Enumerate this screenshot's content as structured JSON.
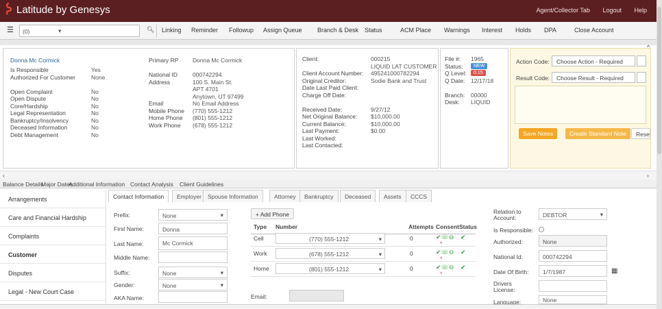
{
  "header": {
    "title": "Latitude by Genesys",
    "agent": "Agent/Collector Tab",
    "logout": "Logout",
    "help": "Help"
  },
  "toolbar": {
    "filter_value": "(0)",
    "items": [
      "Linking",
      "Reminder",
      "Followup",
      "Assign Queue",
      "Branch & Desk",
      "Status",
      "ACM Place",
      "Warnings",
      "Interest",
      "Holds",
      "DPA",
      "Close Account"
    ]
  },
  "summary": {
    "name": "Donna Mc Cormick",
    "left_rows": [
      [
        "Is Responsible",
        "Yes"
      ],
      [
        "Authorized For Customer",
        "None"
      ],
      [
        "",
        ""
      ],
      [
        "Open Complaint",
        "No"
      ],
      [
        "Open Dispute",
        "No"
      ],
      [
        "Core/Hardship",
        "No"
      ],
      [
        "Legal Representation",
        "No"
      ],
      [
        "Bankruptcy/Insolvency",
        "No"
      ],
      [
        "Deceased Information",
        "No"
      ],
      [
        "Debt Management",
        "No"
      ]
    ],
    "contact_rows": [
      [
        "Primary RP",
        "Donna Mc Cormick"
      ],
      [
        "",
        ""
      ],
      [
        "National ID",
        "000742294"
      ],
      [
        "Address",
        "100 S. Main St."
      ],
      [
        "",
        "APT 4701"
      ],
      [
        "",
        "Anytown, UT 97499"
      ],
      [
        "Email",
        "No Email Address"
      ],
      [
        "Mobile Phone",
        "(770) 555-1212"
      ],
      [
        "Home Phone",
        "(801) 555-1212"
      ],
      [
        "Work Phone",
        "(678) 555-1212"
      ]
    ],
    "client_rows": [
      [
        "Client:",
        "000215"
      ],
      [
        "",
        "LIQUID LAT CUSTOMER"
      ],
      [
        "Client Account Number:",
        "495241000782294"
      ],
      [
        "Original Creditor:",
        "Sodie Bank and Trust"
      ],
      [
        "Date Last Paid Client:",
        ""
      ],
      [
        "Charge Off Date:",
        ""
      ],
      [
        "",
        ""
      ],
      [
        "Received Date:",
        "9/27/12"
      ],
      [
        "Net Original Balance:",
        "$10,000.00"
      ],
      [
        "Current Balance:",
        "$10,000.00"
      ],
      [
        "Last Payment:",
        "$0.00"
      ],
      [
        "Last Worked:",
        ""
      ],
      [
        "Last Contacted:",
        ""
      ]
    ],
    "file_rows": [
      [
        "File #:",
        "1965"
      ],
      [
        "Status:",
        "NEW"
      ],
      [
        "Q Level:",
        "0.15"
      ],
      [
        "Q Date:",
        "12/17/18"
      ],
      [
        "",
        ""
      ],
      [
        "Branch:",
        "00000"
      ],
      [
        "Desk:",
        "LIQUID"
      ]
    ],
    "action_code_label": "Action Code:",
    "action_code_value": "Choose Action - Required",
    "result_code_label": "Result Code:",
    "result_code_value": "Choose Result - Required",
    "save_button": "Save Notes",
    "create_note_button": "Create Standard Note",
    "reset_button": "Reset"
  },
  "tab_links": [
    "Balance Details",
    "Major Dates",
    "Additional Information",
    "Contact Analysis",
    "Client Guidelines"
  ],
  "nav_items": [
    "Arrangements",
    "Care and Financial Hardship",
    "Complaints",
    "Customer",
    "Disputes",
    "Legal - New Court Case"
  ],
  "panel_tabs": [
    "Contact Information",
    "Employer",
    "Spouse Information",
    "Attorney",
    "Bankruptcy",
    "Deceased",
    "Assets",
    "CCCS"
  ],
  "form": {
    "prefix_label": "Prefix:",
    "prefix_value": "None",
    "first_label": "First Name:",
    "first_value": "Donna",
    "last_label": "Last Name:",
    "last_value": "Mc Cormick",
    "middle_label": "Middle Name:",
    "middle_value": "",
    "suffix_label": "Suffix:",
    "suffix_value": "None",
    "gender_label": "Gender:",
    "gender_value": "None",
    "aka_label": "AKA Name:",
    "aka_value": "",
    "add_phone": "+ Add Phone",
    "email_label": "Email:"
  },
  "phones": {
    "headers": [
      "Type",
      "Number",
      "Attempts",
      "Consent",
      "Status"
    ],
    "rows": [
      [
        "Cell",
        "(770) 555-1212",
        "0"
      ],
      [
        "Work",
        "(678) 555-1212",
        "0"
      ],
      [
        "Home",
        "(801) 555-1212",
        "0"
      ]
    ]
  },
  "right_form": {
    "relation_label": "Relation to Account:",
    "relation_value": "DEBTOR",
    "responsible_label": "Is Responsible:",
    "authorized_label": "Authorized:",
    "authorized_value": "None",
    "national_label": "National Id:",
    "national_value": "000742294",
    "dob_label": "Date Of Birth:",
    "dob_value": "1/7/1987",
    "license_label": "Drivers License:",
    "language_label": "Language:",
    "language_value": "None"
  },
  "colors": {
    "header": "#5c1f21",
    "accent_orange": "#f5a623",
    "badge_blue": "#4a90d9",
    "badge_red": "#d9534f"
  }
}
